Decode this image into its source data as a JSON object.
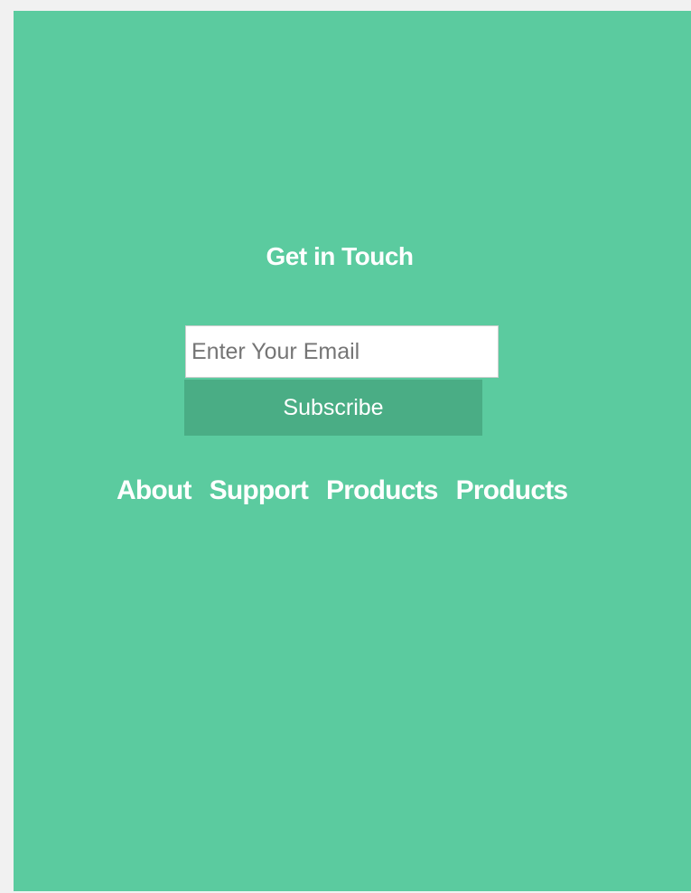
{
  "section": {
    "title": "Get in Touch"
  },
  "form": {
    "email_placeholder": "Enter Your Email",
    "subscribe_label": "Subscribe"
  },
  "nav": {
    "links": [
      {
        "label": "About"
      },
      {
        "label": "Support"
      },
      {
        "label": "Products"
      },
      {
        "label": "Products"
      }
    ]
  },
  "colors": {
    "background": "#5bcb9f",
    "button": "#4aad85",
    "text": "#ffffff"
  }
}
